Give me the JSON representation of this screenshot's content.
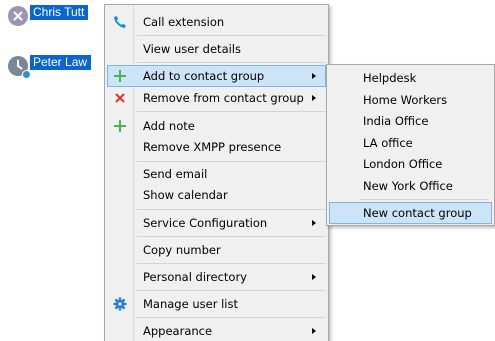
{
  "contacts": [
    {
      "name": "Chris Tutt",
      "icon": "cross-icon",
      "status": "busy"
    },
    {
      "name": "Peter Law",
      "icon": "clock-icon",
      "status": "away"
    }
  ],
  "menu": {
    "items": [
      {
        "label": "Call extension",
        "icon": "phone-icon"
      },
      {
        "label": "View user details"
      },
      {
        "label": "Add to contact group",
        "icon": "plus-icon",
        "submenu": true,
        "highlighted": true
      },
      {
        "label": "Remove from contact group",
        "icon": "red-cross-icon",
        "submenu": true
      },
      {
        "label": "Add note",
        "icon": "plus-icon"
      },
      {
        "label": "Remove XMPP presence"
      },
      {
        "label": "Send email"
      },
      {
        "label": "Show calendar"
      },
      {
        "label": "Service Configuration",
        "submenu": true
      },
      {
        "label": "Copy number"
      },
      {
        "label": "Personal directory",
        "submenu": true
      },
      {
        "label": "Manage user list",
        "icon": "gear-icon"
      },
      {
        "label": "Appearance",
        "submenu": true
      }
    ]
  },
  "submenu": {
    "items": [
      {
        "label": "Helpdesk"
      },
      {
        "label": "Home Workers"
      },
      {
        "label": "India Office"
      },
      {
        "label": "LA office"
      },
      {
        "label": "London Office"
      },
      {
        "label": "New York Office"
      },
      {
        "label": "New contact group",
        "highlighted": true
      }
    ]
  },
  "colors": {
    "selection": "#0a64d2",
    "highlight_bg": "#cce4f7",
    "highlight_border": "#7eb4ea",
    "menu_bg": "#f0f0f0",
    "phone_icon": "#1e90d6",
    "plus_icon": "#4caf50",
    "remove_icon": "#e53935",
    "gear_icon": "#2b7fc9"
  }
}
